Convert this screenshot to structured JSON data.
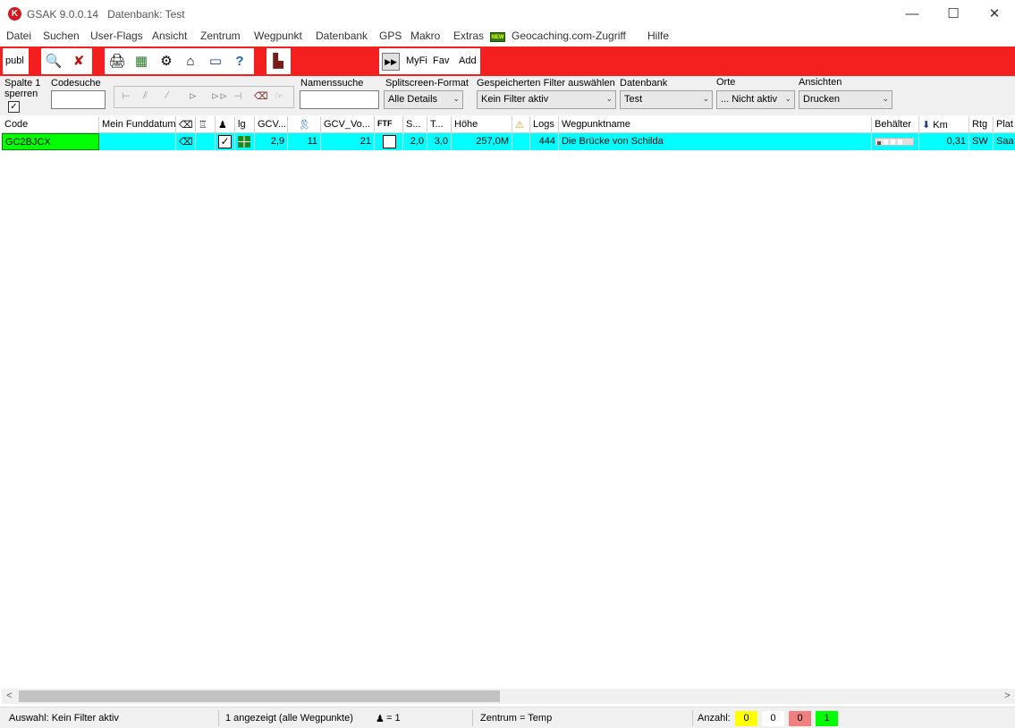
{
  "window": {
    "app_name": "GSAK 9.0.0.14",
    "database_label": "Datenbank: Test",
    "logo_letter": "K",
    "controls": {
      "minimize": "—",
      "maximize": "☐",
      "close": "✕"
    }
  },
  "menu": {
    "items": [
      "Datei",
      "Suchen",
      "User-Flags",
      "Ansicht",
      "Zentrum",
      "Wegpunkt",
      "Datenbank",
      "GPS",
      "Makro",
      "Extras",
      "Geocaching.com-Zugriff",
      "Hilfe"
    ],
    "new_badge": "NEW"
  },
  "toolbar": {
    "publ_label": "publ",
    "myfi_label": "MyFi",
    "fav_label": "Fav",
    "add_label": "Add",
    "accent_color": "#f41f1f"
  },
  "filters": {
    "lock_column_label_line1": "Spalte 1",
    "lock_column_label_line2": "sperren",
    "lock_column_checked": true,
    "code_search_label": "Codesuche",
    "code_search_value": "",
    "name_search_label": "Namenssuche",
    "name_search_value": "",
    "splitscreen_label": "Splitscreen-Format",
    "splitscreen_value": "Alle Details",
    "saved_filter_label": "Gespeicherten Filter auswählen",
    "saved_filter_value": "Kein Filter aktiv",
    "database_label": "Datenbank",
    "database_value": "Test",
    "places_label": "Orte",
    "places_value": "... Nicht aktiv",
    "views_label": "Ansichten",
    "views_value": "Drucken"
  },
  "grid": {
    "headers": {
      "code": "Code",
      "found_date": "Mein Funddatum",
      "lg": "lg",
      "gcv1": "GCV...",
      "gcv_vo": "GCV_Vo...",
      "s": "S...",
      "t": "T...",
      "hoehe": "Höhe",
      "logs": "Logs",
      "name": "Wegpunktname",
      "container": "Behälter",
      "km": "Km",
      "rtg": "Rtg",
      "plat": "Plat"
    },
    "rows": [
      {
        "code": "GC2BJCX",
        "found_date": "",
        "checked": true,
        "gcv1": "2,9",
        "ribbon": "11",
        "gcv_vo": "21",
        "s": "2,0",
        "t": "3,0",
        "hoehe": "257,0M",
        "logs": "444",
        "name": "Die Brücke von Schilda",
        "km": "0,31",
        "rtg": "SW",
        "plat": "Saa"
      }
    ]
  },
  "status": {
    "selection": "Auswahl: Kein Filter aktiv",
    "shown": "1 angezeigt (alle Wegpunkte)",
    "user_count": "= 1",
    "center": "Zentrum = Temp",
    "count_label": "Anzahl:",
    "counts": [
      {
        "value": "0",
        "color": "#ffff00"
      },
      {
        "value": "0",
        "color": "#ffffff"
      },
      {
        "value": "0",
        "color": "#f08080"
      },
      {
        "value": "1",
        "color": "#00ff00"
      }
    ]
  }
}
